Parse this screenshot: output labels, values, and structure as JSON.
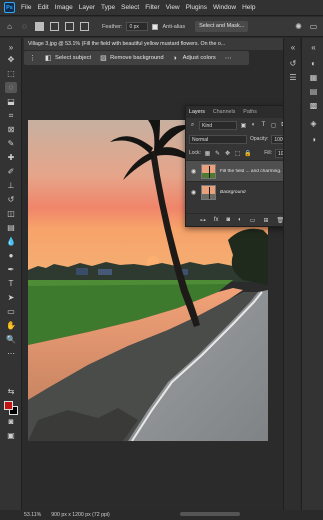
{
  "menubar": {
    "logo": "Ps",
    "items": [
      "File",
      "Edit",
      "Image",
      "Layer",
      "Type",
      "Select",
      "Filter",
      "View",
      "Plugins",
      "Window",
      "Help"
    ]
  },
  "options": {
    "feather_label": "Feather:",
    "feather_value": "0 px",
    "antialias_label": "Anti-alias",
    "select_mask_label": "Select and Mask..."
  },
  "document": {
    "tab_title": "Village 3.jpg @ 53.1% (Fill the field with beautiful yellow mustard flowers. On the o..."
  },
  "taskbar": {
    "select_subject": "Select subject",
    "remove_background": "Remove background",
    "adjust_colors": "Adjust colors"
  },
  "layers_panel": {
    "tabs": [
      "Layers",
      "Channels",
      "Paths"
    ],
    "kind_label": "Kind",
    "blend_mode": "Normal",
    "opacity_label": "Opacity:",
    "opacity_value": "100%",
    "lock_label": "Lock:",
    "fill_label": "Fill:",
    "fill_value": "100%",
    "layers": [
      {
        "name": "Fill the field ... and charming."
      },
      {
        "name": "Background"
      }
    ]
  },
  "statusbar": {
    "zoom": "53.11%",
    "dimensions": "900 px x 1200 px (72 ppi)"
  },
  "colors": {
    "foreground": "#c31414",
    "background": "#000000"
  },
  "icons": [
    "marquee-icon",
    "lasso-icon",
    "brush-icon",
    "eye-icon",
    "lock-icon",
    "trash-icon"
  ]
}
